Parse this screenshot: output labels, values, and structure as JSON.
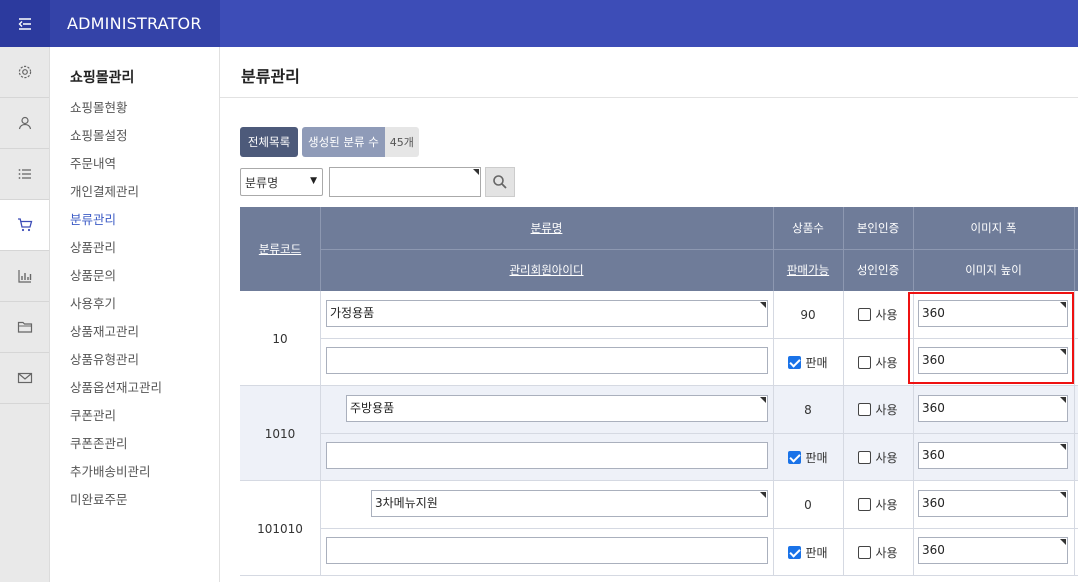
{
  "header": {
    "brand": "ADMINISTRATOR",
    "menu_icon": "collapse-menu-icon",
    "color": "#3d4db7"
  },
  "rail": [
    "gear-icon",
    "user-icon",
    "list-icon",
    "cart-icon",
    "chart-icon",
    "folder-icon",
    "mail-icon"
  ],
  "sidebar": {
    "title": "쇼핑몰관리",
    "items": [
      "쇼핑몰현황",
      "쇼핑몰설정",
      "주문내역",
      "개인결제관리",
      "분류관리",
      "상품관리",
      "상품문의",
      "사용후기",
      "상품재고관리",
      "상품유형관리",
      "상품옵션재고관리",
      "쿠폰관리",
      "쿠폰존관리",
      "추가배송비관리",
      "미완료주문"
    ],
    "active": "분류관리"
  },
  "page": {
    "title": "분류관리",
    "all_list_button": "전체목록",
    "count_label": "생성된 분류 수",
    "count_value": "45개",
    "search_select": "분류명",
    "search_value": ""
  },
  "table": {
    "headers": {
      "code": "분류코드",
      "name": "분류명",
      "member": "관리회원아이디",
      "stock": "상품수",
      "sale": "판매가능",
      "auth": "본인인증",
      "adult": "성인인증",
      "img_w": "이미지 폭",
      "img_h": "이미지 높이"
    },
    "use_label": "사용",
    "sale_label": "판매",
    "rows": [
      {
        "code": "10",
        "name": "가정용품",
        "count": "90",
        "member": "",
        "img_w": "360",
        "img_h": "360"
      },
      {
        "code": "1010",
        "name": "주방용품",
        "count": "8",
        "member": "",
        "img_w": "360",
        "img_h": "360"
      },
      {
        "code": "101010",
        "name": "3차메뉴지원",
        "count": "0",
        "member": "",
        "img_w": "360",
        "img_h": "360"
      }
    ]
  }
}
